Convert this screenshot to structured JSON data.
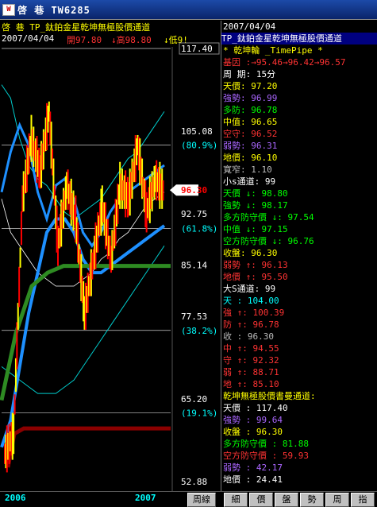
{
  "window": {
    "title": "啓 巷 TW6285",
    "icon": "app-icon"
  },
  "chart_header": {
    "line1_left": "啓 巷 TP_鈦鉑金星乾坤無極股價通道",
    "date": "2007/04/04",
    "open": "開97.80",
    "high": "↓高98.80",
    "low": "↓低9!"
  },
  "price_axis": [
    {
      "label": "117.40",
      "value": 117.4,
      "boxed": true
    },
    {
      "label": "105.08",
      "value": 105.08
    },
    {
      "label": "(80.9%)",
      "value": 103.0,
      "color": "#00ffff"
    },
    {
      "label": "96.30",
      "value": 96.3,
      "current": true
    },
    {
      "label": "92.75",
      "value": 92.75
    },
    {
      "label": "(61.8%)",
      "value": 90.6,
      "color": "#00ffff"
    },
    {
      "label": "85.14",
      "value": 85.14
    },
    {
      "label": "77.53",
      "value": 77.53
    },
    {
      "label": "(38.2%)",
      "value": 75.4,
      "color": "#00ffff"
    },
    {
      "label": "65.20",
      "value": 65.2
    },
    {
      "label": "(19.1%)",
      "value": 63.1,
      "color": "#00ffff"
    },
    {
      "label": "52.88",
      "value": 52.88
    }
  ],
  "x_axis": {
    "labels": [
      "2006",
      "2007"
    ],
    "tab_label": "周線"
  },
  "chart_data": {
    "type": "line",
    "ylim": [
      52.88,
      117.4
    ],
    "current_price": 96.3,
    "series": [
      {
        "values": [
          57,
          60,
          95,
          104,
          99,
          108,
          88,
          97,
          92,
          78,
          86,
          94,
          86,
          97,
          95,
          103,
          93,
          98,
          96
        ]
      }
    ]
  },
  "right_panel": {
    "date": "2007/04/04",
    "title": "TP_鈦鉑金星乾坤無極股價通道",
    "subtitle": "* 乾坤輪 _TimePipe *",
    "base_label": "基因 ",
    "base_value": ":→95.46→96.42→96.57",
    "period_label": "周  期:",
    "period_value": "15分",
    "rows1": [
      {
        "label": "天價",
        "value": ": 97.20",
        "color": "#ffff00"
      },
      {
        "label": "強勢",
        "value": ": 96.99",
        "color": "#aa66ff"
      },
      {
        "label": "多防",
        "value": ": 96.78",
        "color": "#00ff00"
      },
      {
        "label": "中值",
        "value": ": 96.65",
        "color": "#ffff00"
      },
      {
        "label": "空守",
        "value": ": 96.52",
        "color": "#ff3333"
      },
      {
        "label": "弱勢",
        "value": ": 96.31",
        "color": "#aa66ff"
      },
      {
        "label": "地價",
        "value": ": 96.10",
        "color": "#ffff00"
      },
      {
        "label": "寬窄",
        "value": ": 1.10",
        "color": "#bbbbbb"
      }
    ],
    "small_s": "小s通道: 99",
    "rows2": [
      {
        "label": "天價",
        "value": " ↓: 98.80",
        "color": "#00ff00"
      },
      {
        "label": "強勢",
        "value": " ↓: 98.17",
        "color": "#00ff00"
      },
      {
        "label": "多方防守價",
        "value": " ↓: 97.54",
        "color": "#00ff00"
      },
      {
        "label": "中值",
        "value": " ↓: 97.15",
        "color": "#00ff00"
      },
      {
        "label": "空方防守價",
        "value": " ↓: 96.76",
        "color": "#00ff00"
      },
      {
        "label": "收盤",
        "value": ": 96.30",
        "color": "#ffff00"
      },
      {
        "label": "弱勢",
        "value": " ↑: 96.13",
        "color": "#ff3333"
      },
      {
        "label": "地價",
        "value": " ↑: 95.50",
        "color": "#ff3333"
      }
    ],
    "big_s": "大S通道: 99",
    "rows3": [
      {
        "label": "天",
        "value": "   : 104.00",
        "color": "#00ffff"
      },
      {
        "label": "強",
        "value": " ↑: 100.39",
        "color": "#ff3333"
      },
      {
        "label": "防",
        "value": " ↑: 96.78",
        "color": "#ff3333"
      },
      {
        "label": "收",
        "value": "   : 96.30",
        "color": "#bbbbbb"
      },
      {
        "label": "中",
        "value": " ↑: 94.55",
        "color": "#ff3333"
      },
      {
        "label": "守",
        "value": " ↑: 92.32",
        "color": "#ff3333"
      },
      {
        "label": "弱",
        "value": " ↑: 88.71",
        "color": "#ff3333"
      },
      {
        "label": "地",
        "value": " ↑: 85.10",
        "color": "#ff3333"
      }
    ],
    "long_title": "乾坤無極股價書曼通道:",
    "rows4": [
      {
        "label": "天價",
        "value": " : 117.40",
        "color": "#ffffff"
      },
      {
        "label": "強勢",
        "value": " : 99.64",
        "color": "#aa66ff"
      },
      {
        "label": "收盤",
        "value": " : 96.30",
        "color": "#ffff00"
      },
      {
        "label": "多方防守價",
        "value": " : 81.88",
        "color": "#00ff00"
      },
      {
        "label": "空方防守價",
        "value": " : 59.93",
        "color": "#ff3333"
      },
      {
        "label": "弱勢",
        "value": " : 42.17",
        "color": "#aa66ff"
      },
      {
        "label": "地價",
        "value": " : 24.41",
        "color": "#ffffff"
      }
    ]
  },
  "tabs": [
    "細",
    "價",
    "盤",
    "勢",
    "周",
    "指"
  ],
  "colors": {
    "price_up": "#ff0000",
    "price_down": "#ffff00",
    "channel": "#1e90ff",
    "support": "#228b22",
    "resistance": "#8b0000"
  }
}
